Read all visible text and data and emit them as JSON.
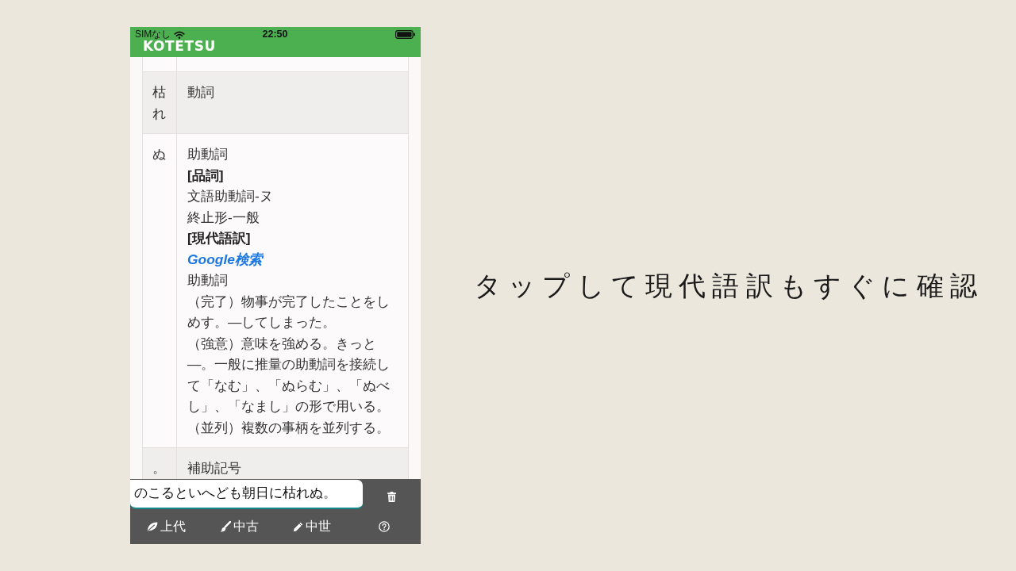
{
  "status_bar": {
    "carrier": "SIMなし",
    "time": "22:50"
  },
  "app_bar": {
    "title": "KOTETSU"
  },
  "results_table": {
    "rows": [
      {
        "word": "枯れ",
        "details": [
          {
            "kind": "text",
            "text": "動詞"
          }
        ]
      },
      {
        "word": "ぬ",
        "details": [
          {
            "kind": "text",
            "text": "助動詞"
          },
          {
            "kind": "heading",
            "text": "[品詞]"
          },
          {
            "kind": "text",
            "text": "文語助動詞-ヌ"
          },
          {
            "kind": "text",
            "text": "終止形-一般"
          },
          {
            "kind": "heading",
            "text": "[現代語訳]"
          },
          {
            "kind": "link",
            "text": "Google検索"
          },
          {
            "kind": "text",
            "text": "助動詞"
          },
          {
            "kind": "text",
            "text": "（完了）物事が完了したことをしめす。―してしまった。"
          },
          {
            "kind": "text",
            "text": "（強意）意味を強める。きっと―。一般に推量の助動詞を接続して「なむ」、「ぬらむ」、「ぬべし」、「なまし」の形で用いる。"
          },
          {
            "kind": "text",
            "text": "（並列）複数の事柄を並列する。"
          }
        ]
      },
      {
        "word": "。",
        "details": [
          {
            "kind": "text",
            "text": "補助記号"
          }
        ]
      }
    ]
  },
  "input": {
    "value": "のこるといへども朝日に枯れぬ。"
  },
  "era_tabs": [
    {
      "label": "上代"
    },
    {
      "label": "中古"
    },
    {
      "label": "中世"
    }
  ],
  "caption": "タップして現代語訳もすぐに確認"
}
